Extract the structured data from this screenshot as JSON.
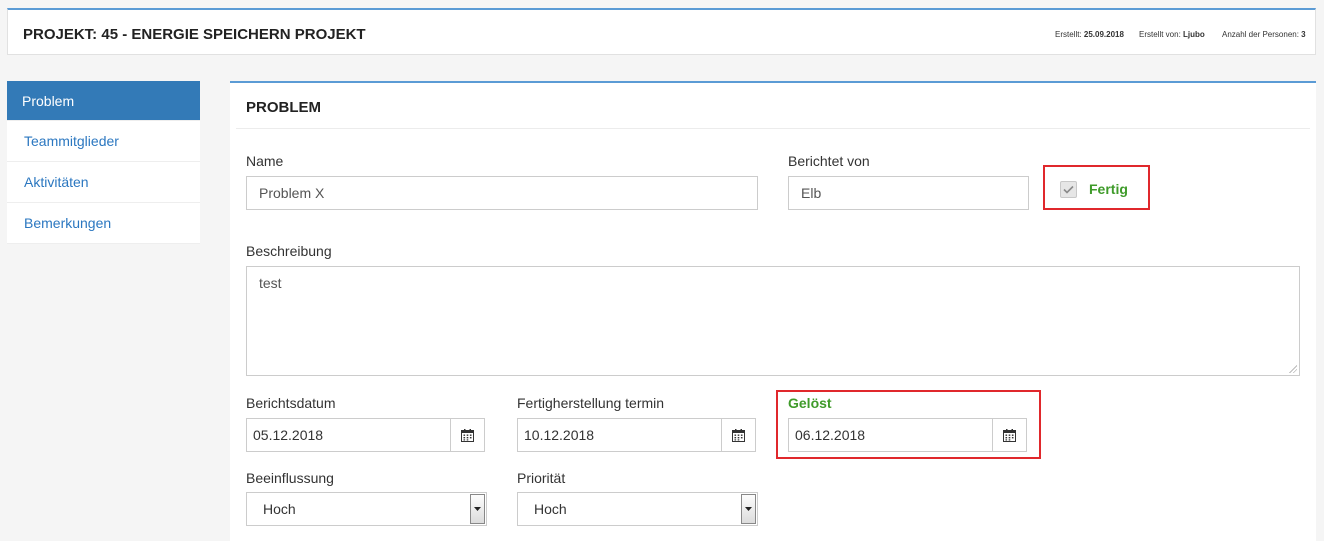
{
  "header": {
    "title": "PROJEKT: 45 - ENERGIE SPEICHERN PROJEKT",
    "created_label": "Erstellt:",
    "created_value": "25.09.2018",
    "created_by_label": "Erstellt von:",
    "created_by_value": "Ljubo",
    "persons_label": "Anzahl der Personen:",
    "persons_value": "3"
  },
  "sidebar": {
    "items": [
      {
        "label": "Problem",
        "active": true
      },
      {
        "label": "Teammitglieder"
      },
      {
        "label": "Aktivitäten"
      },
      {
        "label": "Bemerkungen"
      }
    ]
  },
  "panel": {
    "title": "PROBLEM",
    "name": {
      "label": "Name",
      "value": "Problem X"
    },
    "reported_by": {
      "label": "Berichtet von",
      "value": "Elb"
    },
    "done": {
      "label": "Fertig",
      "checked": true
    },
    "description": {
      "label": "Beschreibung",
      "value": "test"
    },
    "report_date": {
      "label": "Berichtsdatum",
      "value": "05.12.2018"
    },
    "completion_date": {
      "label": "Fertigherstellung termin",
      "value": "10.12.2018"
    },
    "solved": {
      "label": "Gelöst",
      "value": "06.12.2018"
    },
    "influence": {
      "label": "Beeinflussung",
      "value": "Hoch"
    },
    "priority": {
      "label": "Priorität",
      "value": "Hoch"
    }
  },
  "colors": {
    "accent": "#337ab7",
    "success": "#3f9b2a",
    "highlight": "#e0282c"
  }
}
